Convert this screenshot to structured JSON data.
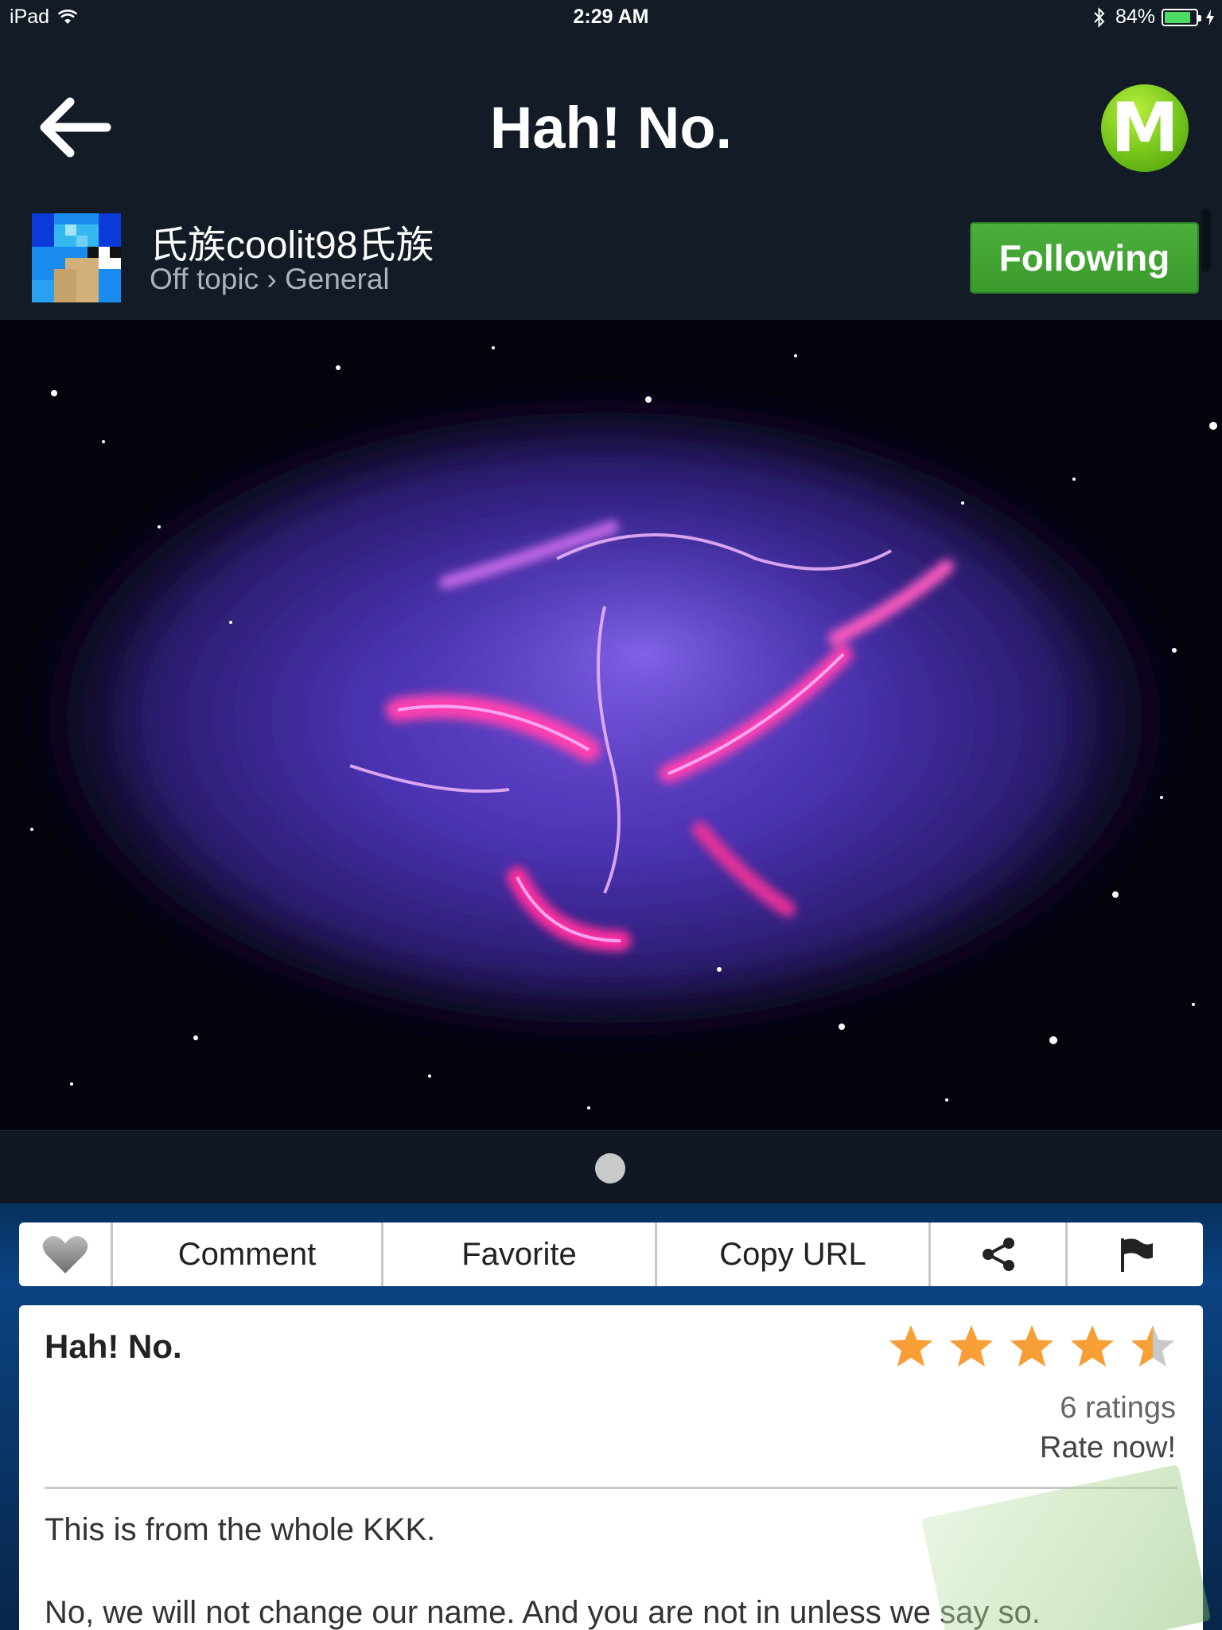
{
  "status_bar": {
    "device": "iPad",
    "time": "2:29 AM",
    "battery_percent": "84%",
    "battery_level": 0.84,
    "icons": [
      "wifi-icon",
      "bluetooth-icon",
      "battery-icon",
      "charging-icon"
    ]
  },
  "nav": {
    "title": "Hah! No.",
    "back_icon": "back-arrow-icon",
    "logo_letter": "M"
  },
  "author": {
    "username": "氏族coolit98氏族",
    "category": "Off topic › General",
    "follow_label": "Following"
  },
  "pager": {
    "page_count": 1,
    "current_page": 1
  },
  "actions": {
    "like_icon": "heart-icon",
    "comment": "Comment",
    "favorite": "Favorite",
    "copy_url": "Copy URL",
    "share_icon": "share-icon",
    "report_icon": "flag-icon"
  },
  "post": {
    "title": "Hah! No.",
    "rating_value": 4.5,
    "rating_max": 5,
    "ratings_count": "6 ratings",
    "rate_now": "Rate now!",
    "body": [
      "This is from the whole KKK.",
      "No, we will not change our name. And you are not in unless we say so."
    ]
  },
  "colors": {
    "background": "#121b26",
    "following_green": "#3a9a2c",
    "logo_green": "#73c41a",
    "star_orange": "#f7a234",
    "lower_blue": "#0b4384"
  }
}
